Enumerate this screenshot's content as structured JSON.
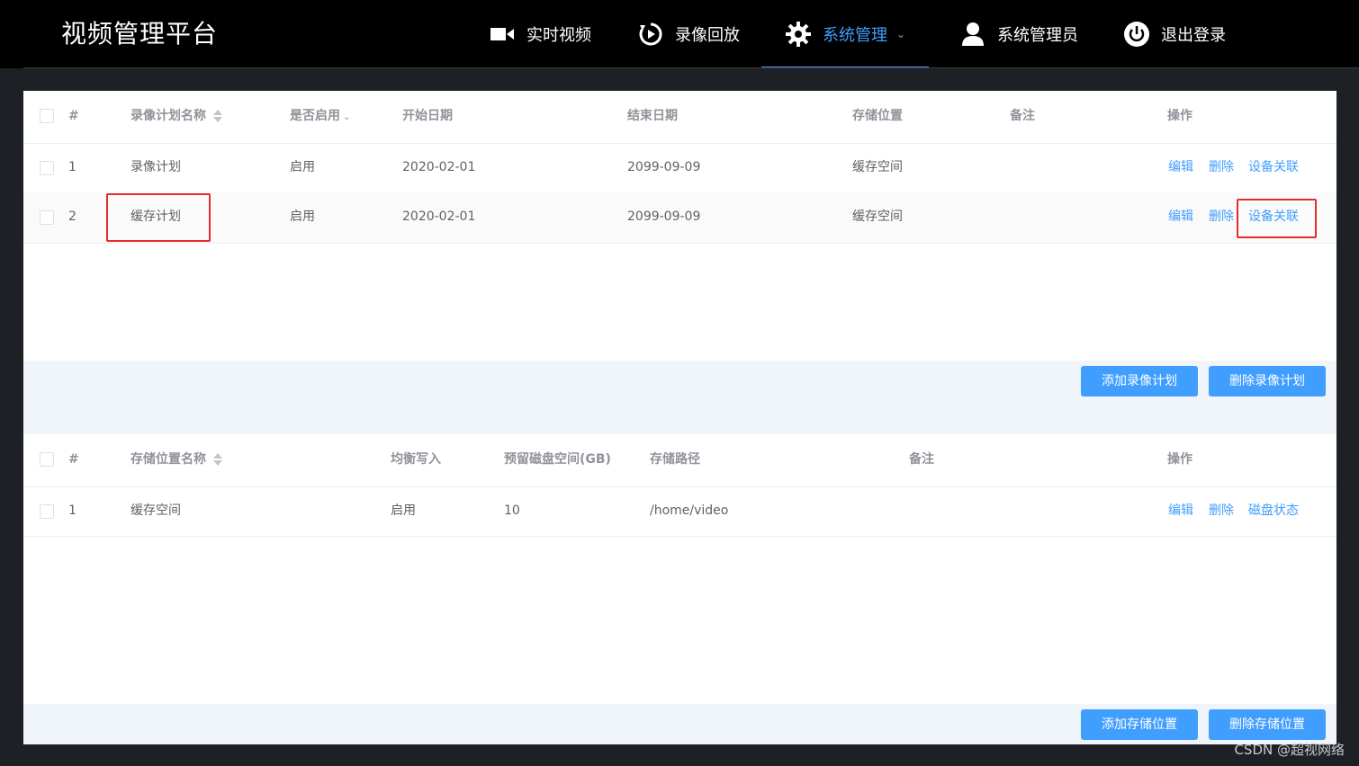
{
  "app": {
    "title": "视频管理平台"
  },
  "nav": {
    "items": [
      {
        "label": "实时视频",
        "icon": "video-camera-icon"
      },
      {
        "label": "录像回放",
        "icon": "playback-icon"
      },
      {
        "label": "系统管理",
        "icon": "gear-icon",
        "active": true
      },
      {
        "label": "系统管理员",
        "icon": "user-icon"
      },
      {
        "label": "退出登录",
        "icon": "power-icon"
      }
    ]
  },
  "record_table": {
    "headers": [
      "#",
      "录像计划名称",
      "是否启用",
      "开始日期",
      "结束日期",
      "存储位置",
      "备注",
      "操作"
    ],
    "rows": [
      {
        "index": "1",
        "name": "录像计划",
        "enabled": "启用",
        "start": "2020-02-01",
        "end": "2099-09-09",
        "storage": "缓存空间",
        "note": "",
        "actions": [
          "编辑",
          "删除",
          "设备关联"
        ]
      },
      {
        "index": "2",
        "name": "缓存计划",
        "enabled": "启用",
        "start": "2020-02-01",
        "end": "2099-09-09",
        "storage": "缓存空间",
        "note": "",
        "actions": [
          "编辑",
          "删除",
          "设备关联"
        ]
      }
    ],
    "buttons": {
      "add": "添加录像计划",
      "delete": "删除录像计划"
    }
  },
  "storage_table": {
    "headers": [
      "#",
      "存储位置名称",
      "均衡写入",
      "预留磁盘空间(GB)",
      "存储路径",
      "备注",
      "操作"
    ],
    "rows": [
      {
        "index": "1",
        "name": "缓存空间",
        "balanced": "启用",
        "reserved": "10",
        "path": "/home/video",
        "note": "",
        "actions": [
          "编辑",
          "删除",
          "磁盘状态"
        ]
      }
    ],
    "buttons": {
      "add": "添加存储位置",
      "delete": "删除存储位置"
    }
  },
  "watermark": "CSDN @超视网络",
  "colors": {
    "accent": "#409eff",
    "highlight": "#e52b2b",
    "topbar": "#000000"
  }
}
